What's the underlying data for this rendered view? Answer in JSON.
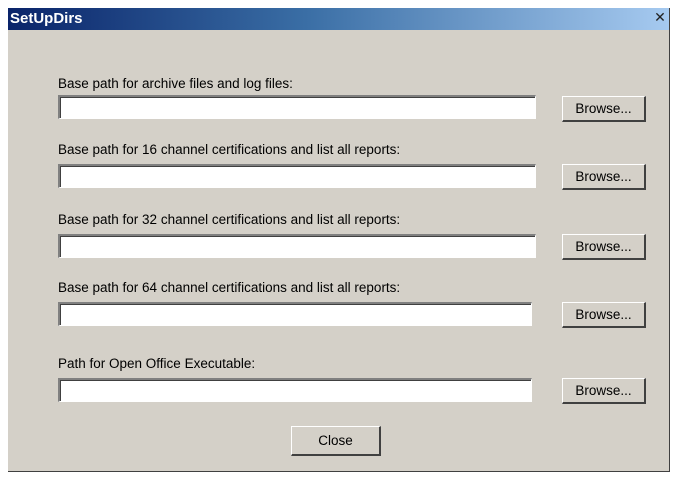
{
  "window": {
    "title": "SetUpDirs",
    "close_glyph": "✕"
  },
  "rows": [
    {
      "label": "Base path for archive files and log files:",
      "value": "",
      "browse_label": "Browse..."
    },
    {
      "label": "Base path for 16 channel certifications and list all reports:",
      "value": "",
      "browse_label": "Browse..."
    },
    {
      "label": "Base path for 32 channel certifications and list all reports:",
      "value": "",
      "browse_label": "Browse..."
    },
    {
      "label": "Base path for 64 channel certifications and list all reports:",
      "value": "",
      "browse_label": "Browse..."
    },
    {
      "label": "Path for Open Office Executable:",
      "value": "",
      "browse_label": "Browse..."
    }
  ],
  "close_button": {
    "label": "Close"
  }
}
